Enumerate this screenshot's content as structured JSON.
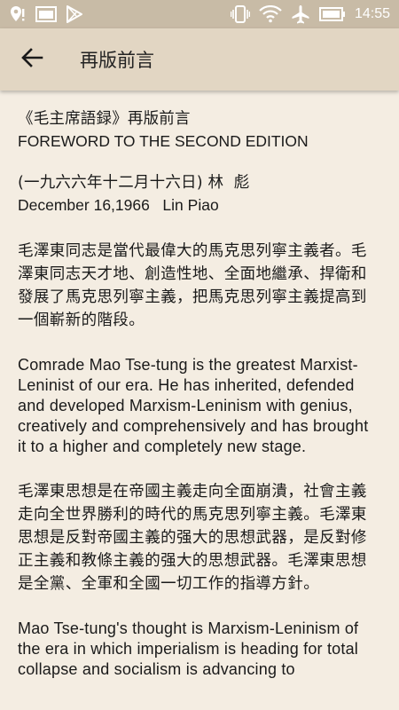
{
  "status_bar": {
    "time": "14:55",
    "icons": [
      "location-icon",
      "image-icon",
      "play-store-icon",
      "vibrate-icon",
      "wifi-icon",
      "airplane-icon",
      "battery-icon"
    ]
  },
  "app_bar": {
    "title": "再版前言",
    "back_icon": "arrow-left-icon"
  },
  "content": {
    "heading_cn": "《毛主席語録》再版前言",
    "heading_en": "FOREWORD TO THE SECOND EDITION",
    "date_cn": "(一九六六年十二月十六日) 林  彪",
    "date_en": "December 16,1966   Lin Piao",
    "para1_cn": "毛澤東同志是當代最偉大的馬克思列寧主義者。毛澤東同志天才地、創造性地、全面地繼承、捍衛和發展了馬克思列寧主義，把馬克思列寧主義提高到一個嶄新的階段。",
    "para1_en": "Comrade Mao Tse-tung is the greatest Marxist-Leninist of our era. He has inherited, defended and developed Marxism-Leninism with genius, creatively and comprehensively and has brought it to a higher and completely new stage.",
    "para2_cn": "毛澤東思想是在帝國主義走向全面崩潰，社會主義走向全世界勝利的時代的馬克思列寧主義。毛澤東思想是反對帝國主義的强大的思想武器，是反對修正主義和教條主義的强大的思想武器。毛澤東思想是全黨、全軍和全國一切工作的指導方針。",
    "para2_en": "Mao Tse-tung's thought is Marxism-Leninism of the era in which imperialism is heading for total collapse and socialism is advancing to"
  }
}
